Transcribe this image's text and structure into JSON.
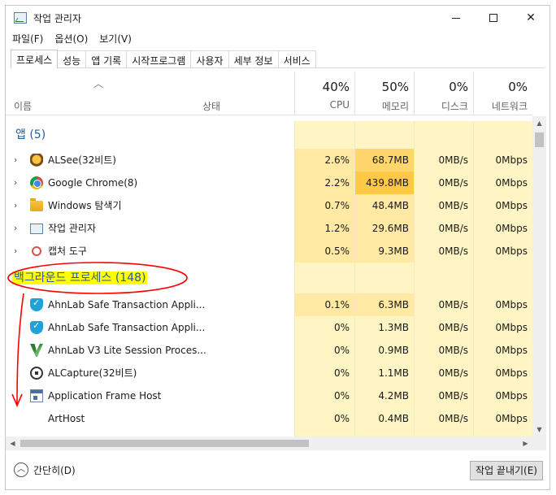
{
  "window": {
    "title": "작업 관리자"
  },
  "menu": [
    "파일(F)",
    "옵션(O)",
    "보기(V)"
  ],
  "tabs": [
    "프로세스",
    "성능",
    "앱 기록",
    "시작프로그램",
    "사용자",
    "세부 정보",
    "서비스"
  ],
  "header": {
    "name": "이름",
    "status": "상태",
    "cpu": {
      "pct": "40%",
      "label": "CPU"
    },
    "memory": {
      "pct": "50%",
      "label": "메모리"
    },
    "disk": {
      "pct": "0%",
      "label": "디스크"
    },
    "network": {
      "pct": "0%",
      "label": "네트워크"
    }
  },
  "groups": {
    "apps": "앱 (5)",
    "background": "백그라운드 프로세스 (148)"
  },
  "apps": [
    {
      "name": "ALSee(32비트)",
      "icon": "alsee-icon",
      "cpu": "2.6%",
      "mem": "68.7MB",
      "disk": "0MB/s",
      "net": "0Mbps"
    },
    {
      "name": "Google Chrome(8)",
      "icon": "chrome-icon",
      "cpu": "2.2%",
      "mem": "439.8MB",
      "disk": "0MB/s",
      "net": "0Mbps"
    },
    {
      "name": "Windows 탐색기",
      "icon": "folder-icon",
      "cpu": "0.7%",
      "mem": "48.4MB",
      "disk": "0MB/s",
      "net": "0Mbps"
    },
    {
      "name": "작업 관리자",
      "icon": "task-manager-icon",
      "cpu": "1.2%",
      "mem": "29.6MB",
      "disk": "0MB/s",
      "net": "0Mbps"
    },
    {
      "name": "캡처 도구",
      "icon": "snipping-tool-icon",
      "cpu": "0.5%",
      "mem": "9.3MB",
      "disk": "0MB/s",
      "net": "0Mbps"
    }
  ],
  "background": [
    {
      "name": "AhnLab Safe Transaction Appli...",
      "icon": "shield-icon",
      "cpu": "0.1%",
      "mem": "6.3MB",
      "disk": "0MB/s",
      "net": "0Mbps"
    },
    {
      "name": "AhnLab Safe Transaction Appli...",
      "icon": "shield-icon",
      "cpu": "0%",
      "mem": "1.3MB",
      "disk": "0MB/s",
      "net": "0Mbps"
    },
    {
      "name": "AhnLab V3 Lite Session Proces...",
      "icon": "v3-icon",
      "cpu": "0%",
      "mem": "0.9MB",
      "disk": "0MB/s",
      "net": "0Mbps"
    },
    {
      "name": "ALCapture(32비트)",
      "icon": "alcapture-icon",
      "cpu": "0%",
      "mem": "1.1MB",
      "disk": "0MB/s",
      "net": "0Mbps"
    },
    {
      "name": "Application Frame Host",
      "icon": "app-window-icon",
      "cpu": "0%",
      "mem": "4.2MB",
      "disk": "0MB/s",
      "net": "0Mbps"
    },
    {
      "name": "ArtHost",
      "icon": "blank-icon",
      "cpu": "0%",
      "mem": "0.4MB",
      "disk": "0MB/s",
      "net": "0Mbps"
    }
  ],
  "footer": {
    "collapse": "간단히(D)",
    "end_task": "작업 끝내기(E)"
  },
  "colors": {
    "group_label": "#2b5a9c",
    "highlight": "#ffff00",
    "annotation": "#ff0000",
    "heat_light": "#fff4c4",
    "heat_mid": "#ffe9a3",
    "heat_dark": "#ffd66b"
  }
}
